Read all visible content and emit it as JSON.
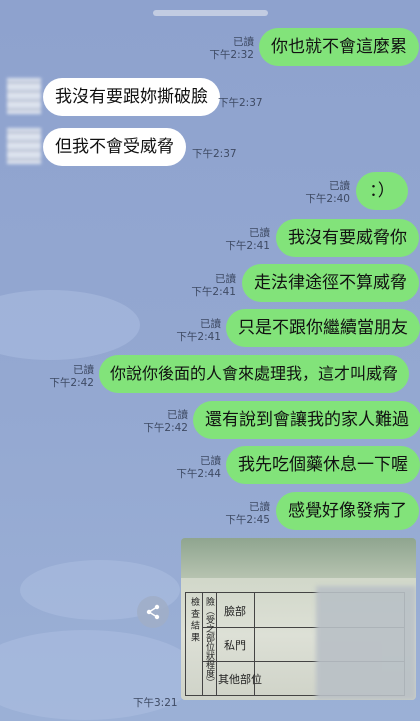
{
  "messages": [
    {
      "dir": "out",
      "text": "你也就不會這麼累",
      "read": "已讀",
      "time": "下午2:32"
    },
    {
      "dir": "in",
      "text": "我沒有要跟妳撕破臉",
      "time": "下午2:37"
    },
    {
      "dir": "in",
      "text": "但我不會受威脅",
      "time": "下午2:37"
    },
    {
      "dir": "out",
      "text": "：）",
      "read": "已讀",
      "time": "下午2:40"
    },
    {
      "dir": "out",
      "text": "我沒有要威脅你",
      "read": "已讀",
      "time": "下午2:41"
    },
    {
      "dir": "out",
      "text": "走法律途徑不算威脅",
      "read": "已讀",
      "time": "下午2:41"
    },
    {
      "dir": "out",
      "text": "只是不跟你繼續當朋友",
      "read": "已讀",
      "time": "下午2:41"
    },
    {
      "dir": "out",
      "text": "你說你後面的人會來處理我，這才叫威脅",
      "read": "已讀",
      "time": "下午2:42"
    },
    {
      "dir": "out",
      "text": "還有說到會讓我的家人難過",
      "read": "已讀",
      "time": "下午2:42"
    },
    {
      "dir": "out",
      "text": "我先吃個藥休息一下喔",
      "read": "已讀",
      "time": "下午2:44"
    },
    {
      "dir": "out",
      "text": "感覺好像發病了",
      "read": "已讀",
      "time": "下午2:45"
    }
  ],
  "photo_message": {
    "time": "下午3:21",
    "form_vertical_text": "險（受之部位狀程度）",
    "form_left_char": "檢 查 結 果",
    "form_rows": [
      "臉部",
      "私門",
      "其他部位"
    ]
  },
  "icons": {
    "share": "share-icon"
  },
  "colors": {
    "background": "#8fa3cf",
    "outgoing_bubble": "#82e37a",
    "incoming_bubble": "#ffffff"
  }
}
